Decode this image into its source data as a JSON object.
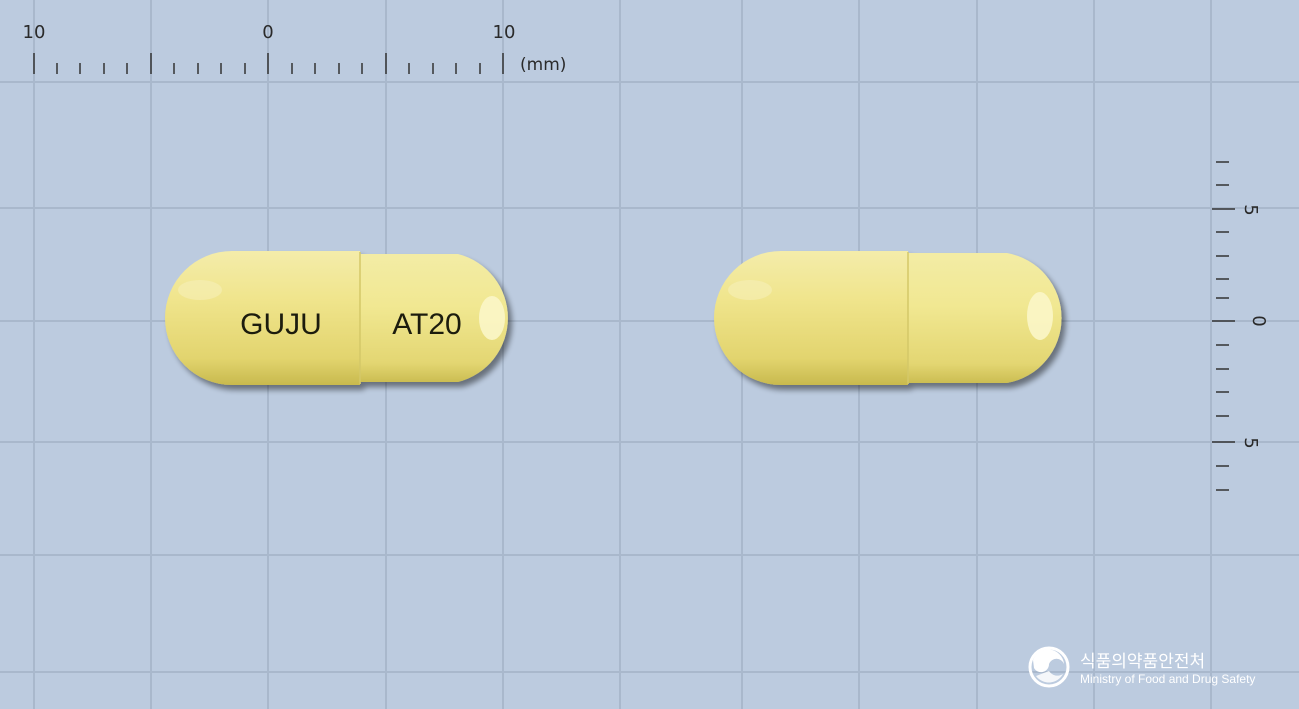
{
  "ruler_top": {
    "labels": [
      "10",
      "0",
      "10"
    ],
    "unit": "(mm)"
  },
  "ruler_right": {
    "labels": [
      "5",
      "0",
      "5"
    ]
  },
  "capsule_front": {
    "imprint_left": "GUJU",
    "imprint_right": "AT20"
  },
  "capsule_back": {},
  "logo": {
    "korean_name": "식품의약품안전처",
    "english_name": "Ministry of Food and Drug Safety"
  },
  "colors": {
    "background": "#bccbdf",
    "grid_line": "#a9b8cc",
    "capsule_yellow": "#efe68a",
    "capsule_shadow": "#c9bd52"
  }
}
